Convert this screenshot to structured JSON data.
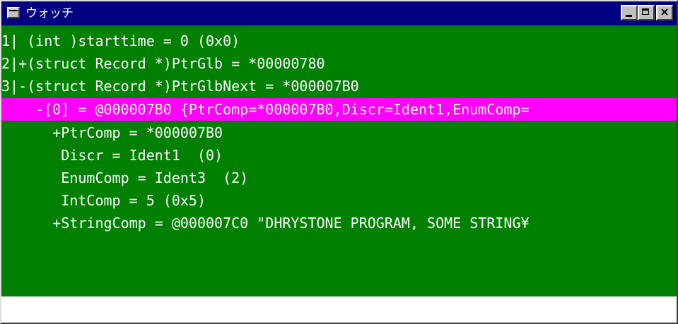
{
  "window": {
    "title": "ウォッチ"
  },
  "lines": [
    {
      "text": "1| (int )starttime = 0 (0x0)"
    },
    {
      "text": "2|+(struct Record *)PtrGlb = *00000780"
    },
    {
      "text": "3|-(struct Record *)PtrGlbNext = *000007B0"
    },
    {
      "text": "    -[0] = @000007B0 {PtrComp=*000007B0,Discr=Ident1,EnumComp="
    },
    {
      "text": "      +PtrComp = *000007B0"
    },
    {
      "text": "       Discr = Ident1  (0)"
    },
    {
      "text": "       EnumComp = Ident3  (2)"
    },
    {
      "text": "       IntComp = 5 (0x5)"
    },
    {
      "text": "      +StringComp = @000007C0 \"DHRYSTONE PROGRAM, SOME STRING¥"
    }
  ],
  "colors": {
    "background": "#008000",
    "text": "#ffffff",
    "selection": "#ff00ff",
    "titlebar": "#000080"
  }
}
